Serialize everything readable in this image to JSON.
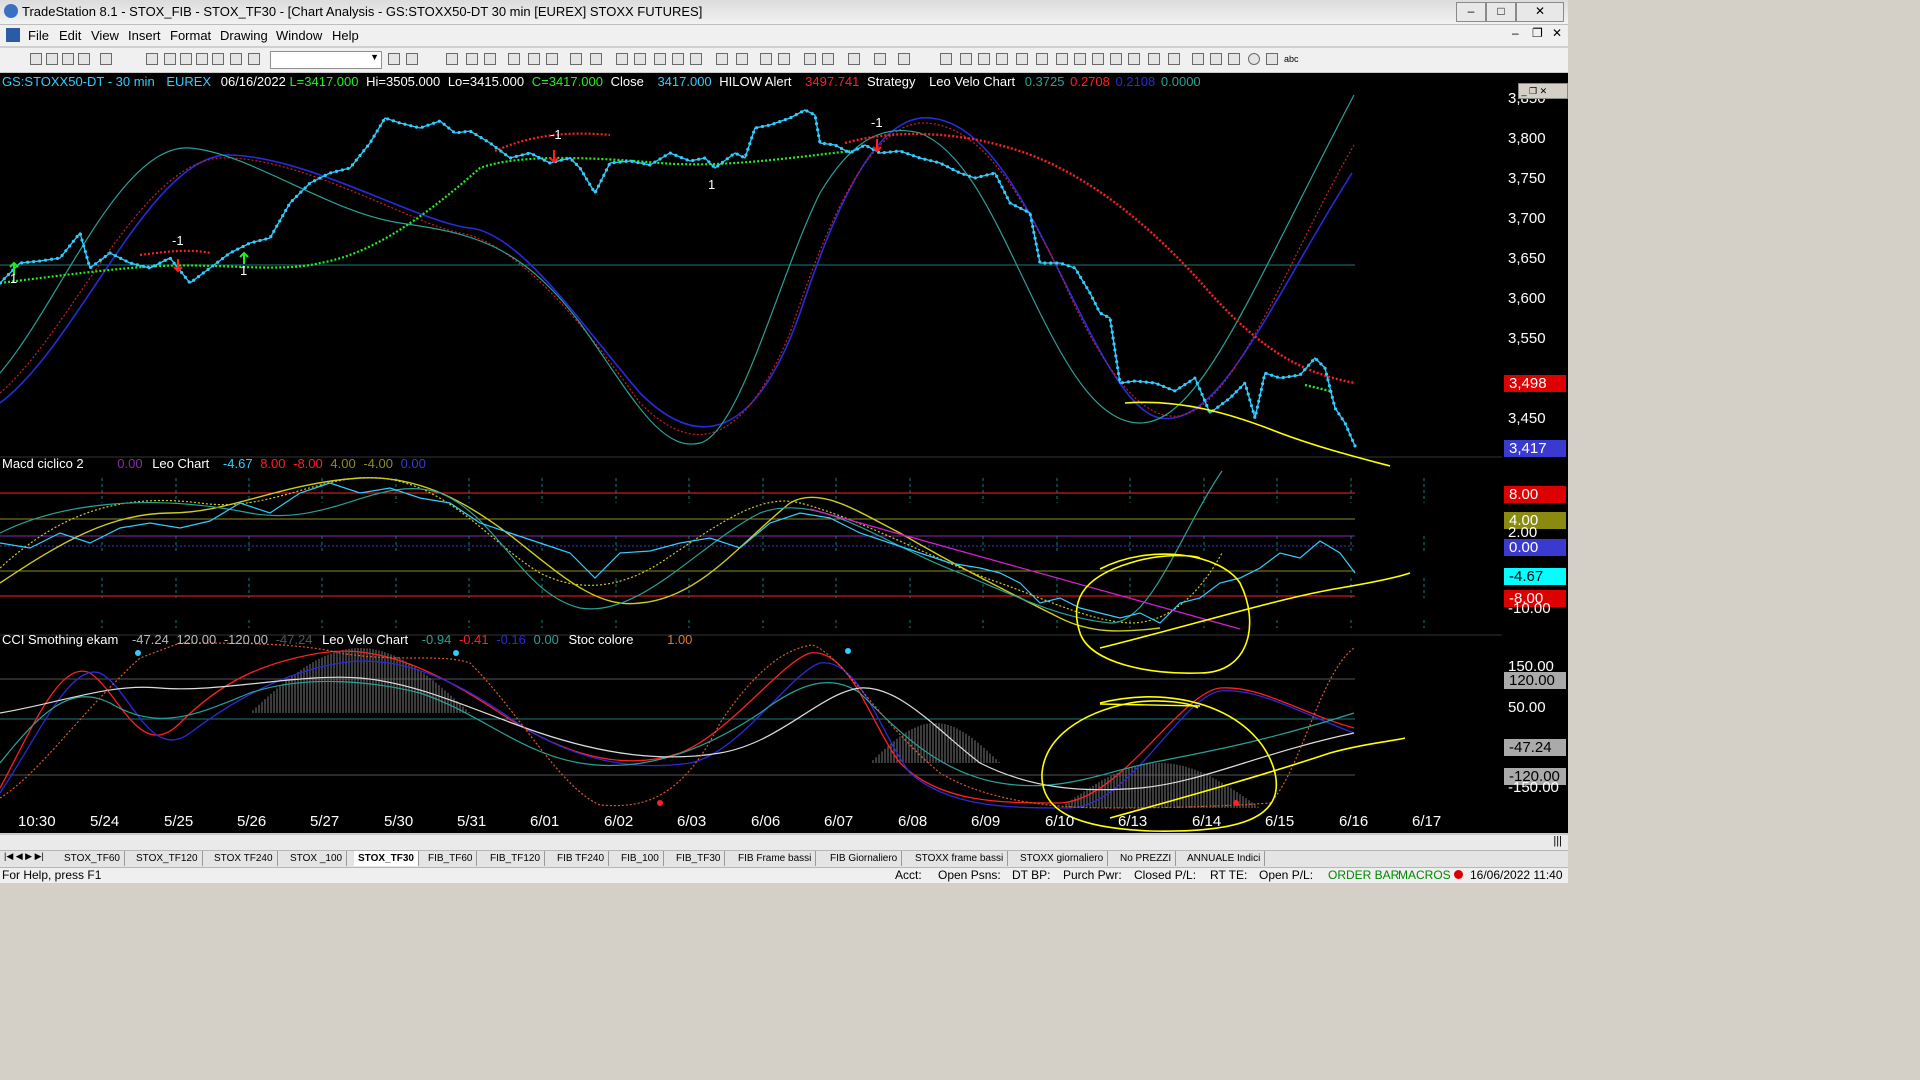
{
  "window": {
    "title": "TradeStation 8.1 - STOX_FIB - STOX_TF30 - [Chart Analysis - GS:STOXX50-DT  30 min  [EUREX] STOXX FUTURES]"
  },
  "menu": [
    "File",
    "Edit",
    "View",
    "Insert",
    "Format",
    "Drawing",
    "Window",
    "Help"
  ],
  "price_header": {
    "symbol": "GS:STOXX50-DT - 30 min",
    "exchange": "EUREX",
    "date": "06/16/2022",
    "last": "L=3417.000",
    "hi": "Hi=3505.000",
    "lo": "Lo=3415.000",
    "close_val": "C=3417.000",
    "close_lbl": "Close",
    "close_num": "3417.000",
    "hilow_lbl": "HILOW Alert",
    "hilow_val": "3497.741",
    "strategy": "Strategy",
    "leo": "Leo Velo Chart",
    "v1": "0.3725",
    "v2": "0.2708",
    "v3": "0.2108",
    "v4": "0.0000"
  },
  "macd_header": {
    "title": "Macd ciclico 2",
    "v0": "0.00",
    "leo": "Leo Chart",
    "v1": "-4.67",
    "v2": "8.00",
    "v3": "-8.00",
    "v4": "4.00",
    "v5": "-4.00",
    "v6": "0.00"
  },
  "cci_header": {
    "title": "CCI Smothing ekam",
    "v1": "-47.24",
    "v2": "120.00",
    "v3": "-120.00",
    "v4": "-47.24",
    "leo": "Leo Velo Chart",
    "v5": "-0.94",
    "v6": "-0.41",
    "v7": "-0.16",
    "v8": "0.00",
    "stoc": "Stoc colore",
    "v9": "1.00"
  },
  "price_axis": [
    "3,850",
    "3,800",
    "3,750",
    "3,700",
    "3,650",
    "3,600",
    "3,550",
    "3,450"
  ],
  "price_boxes": {
    "hilow": "3,498",
    "last": "3,417"
  },
  "macd_axis": {
    "top": "8.00",
    "four": "4.00",
    "two": "2.00",
    "zero": "0.00",
    "cur": "-4.67",
    "neg8": "-8.00",
    "neg10": "-10.00"
  },
  "cci_axis": {
    "p150": "150.00",
    "p120": "120.00",
    "p50": "50.00",
    "cur": "-47.24",
    "n120": "-120.00",
    "n150": "-150.00"
  },
  "date_axis": [
    "10:30",
    "5/24",
    "5/25",
    "5/26",
    "5/27",
    "5/30",
    "5/31",
    "6/01",
    "6/02",
    "6/03",
    "6/06",
    "6/07",
    "6/08",
    "6/09",
    "6/10",
    "6/13",
    "6/14",
    "6/15",
    "6/16",
    "6/17"
  ],
  "markers": {
    "m1": "-1",
    "m2": "1",
    "m3": "-1",
    "m4": "1",
    "m5": "-1",
    "m6": "1"
  },
  "tabs": [
    "STOX_TF60",
    "STOX_TF120",
    "STOX TF240",
    "STOX _100",
    "STOX_TF30",
    "FIB_TF60",
    "FIB_TF120",
    "FIB TF240",
    "FIB_100",
    "FIB_TF30",
    "FIB Frame bassi",
    "FIB Giornaliero",
    "STOXX frame bassi",
    "STOXX giornaliero",
    "No PREZZI",
    "ANNUALE Indici"
  ],
  "active_tab": "STOX_TF30",
  "status": {
    "help": "For Help, press F1",
    "acct": "Acct:",
    "open_psns": "Open Psns:",
    "dt_bp": "DT BP:",
    "purch_pwr": "Purch Pwr:",
    "closed_pl": "Closed P/L:",
    "rt_te": "RT TE:",
    "open_pl": "Open P/L:",
    "order_bar": "ORDER BAR",
    "macros": "MACROS",
    "datetime": "16/06/2022 11:40"
  },
  "colors": {
    "background": "#000000",
    "price": "#33ccff",
    "ma_red": "#ff2020",
    "ma_green": "#22ee22",
    "teal": "#2aa198",
    "blue": "#2a2adc",
    "annotation": "#ffff00",
    "white": "#ffffff"
  }
}
